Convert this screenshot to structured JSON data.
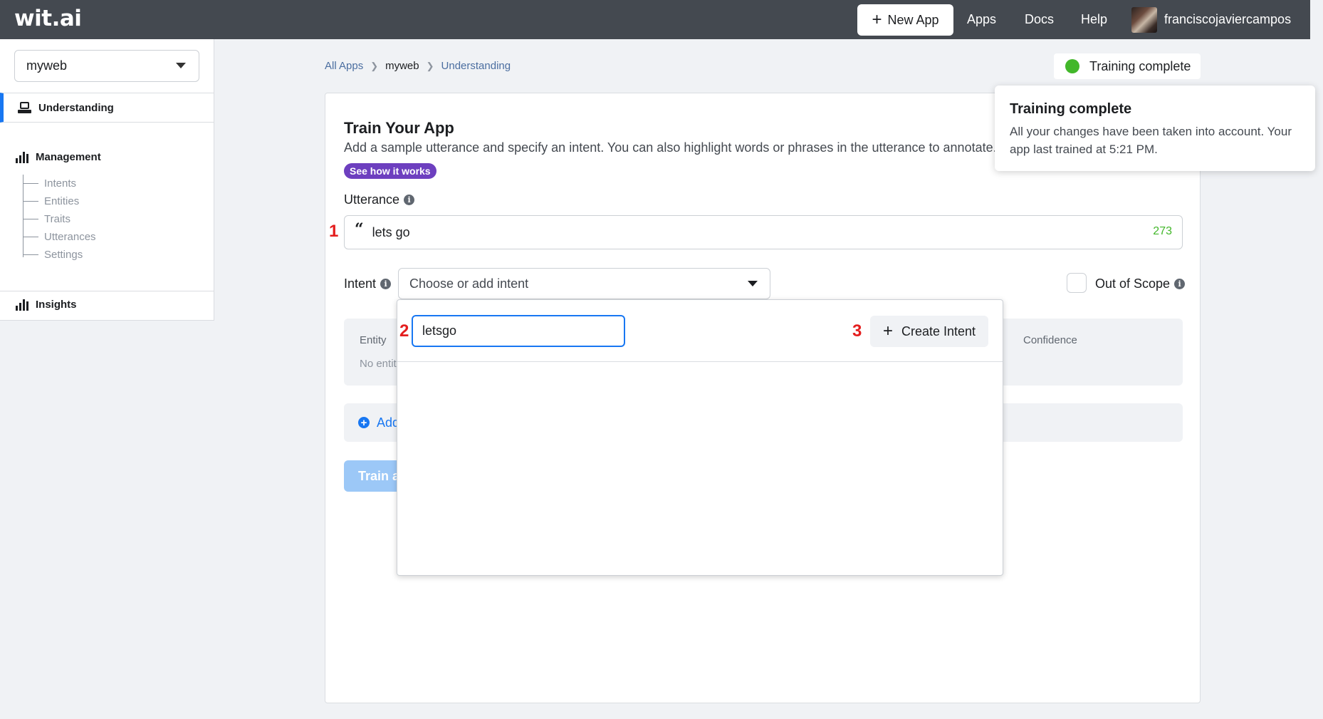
{
  "topbar": {
    "logo": "wit.ai",
    "new_app_label": "New App",
    "nav": [
      "Apps",
      "Docs",
      "Help"
    ],
    "username": "franciscojaviercampos"
  },
  "sidebar": {
    "app_select": "myweb",
    "understanding": "Understanding",
    "management": "Management",
    "management_items": [
      "Intents",
      "Entities",
      "Traits",
      "Utterances",
      "Settings"
    ],
    "insights": "Insights"
  },
  "breadcrumb": {
    "all_apps": "All Apps",
    "app": "myweb",
    "page": "Understanding"
  },
  "status": {
    "label": "Training complete",
    "color": "#42b72a"
  },
  "train": {
    "title": "Train Your App",
    "description": "Add a sample utterance and specify an intent. You can also highlight words or phrases in the utterance to annotate.",
    "see_how": "See how it works",
    "utterance_label": "Utterance",
    "utterance_value": "lets go",
    "char_count": "273",
    "intent_label": "Intent",
    "intent_placeholder": "Choose or add intent",
    "out_of_scope_label": "Out of Scope",
    "entity_header": "Entity",
    "confidence_header": "Confidence",
    "no_entities": "No entiti",
    "add_label": "Add",
    "train_button": "Train a"
  },
  "dropdown": {
    "search_value": "letsgo",
    "create_label": "Create Intent"
  },
  "annotations": [
    "1",
    "2",
    "3"
  ],
  "toast": {
    "title": "Training complete",
    "body": "All your changes have been taken into account. Your app last trained at 5:21 PM."
  },
  "colors": {
    "accent": "#1877f2",
    "topbar": "#444950",
    "purple_badge": "#6d3fbf",
    "annotation": "#e41e1e"
  }
}
